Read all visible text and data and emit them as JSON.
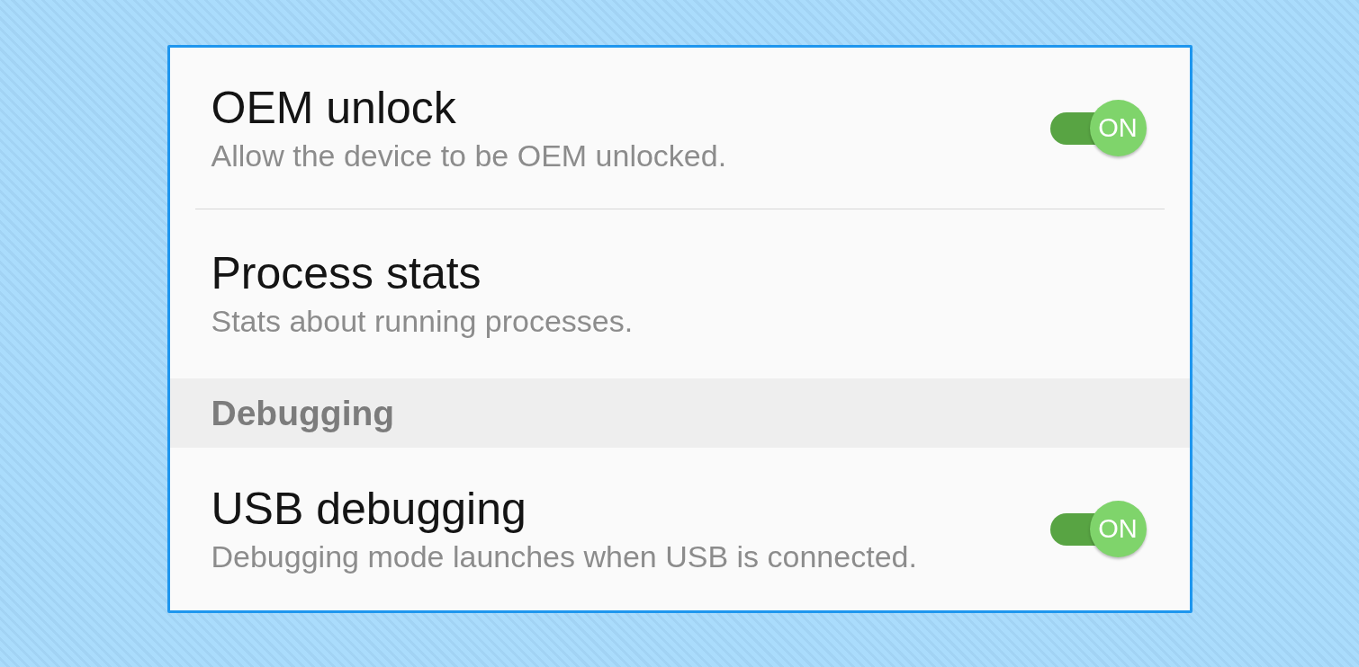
{
  "settings": {
    "items": [
      {
        "kind": "switch",
        "title": "OEM unlock",
        "subtitle": "Allow the device to be OEM unlocked.",
        "on": true,
        "switch_label": "ON"
      },
      {
        "kind": "text",
        "title": "Process stats",
        "subtitle": "Stats about running processes."
      },
      {
        "kind": "header",
        "title": "Debugging"
      },
      {
        "kind": "switch",
        "title": "USB debugging",
        "subtitle": "Debugging mode launches when USB is connected.",
        "on": true,
        "switch_label": "ON"
      }
    ]
  }
}
